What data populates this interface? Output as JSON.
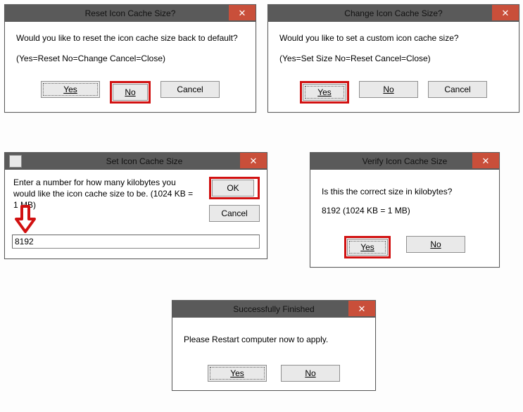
{
  "dialogs": {
    "reset": {
      "title": "Reset Icon Cache Size?",
      "line1": "Would you like to reset the icon cache size back to default?",
      "line2": "(Yes=Reset   No=Change   Cancel=Close)",
      "yes": "Yes",
      "no": "No",
      "cancel": "Cancel"
    },
    "change": {
      "title": "Change Icon Cache Size?",
      "line1": "Would you like to set a custom icon cache size?",
      "line2": "(Yes=Set Size   No=Reset   Cancel=Close)",
      "yes": "Yes",
      "no": "No",
      "cancel": "Cancel"
    },
    "set": {
      "title": "Set Icon Cache Size",
      "line1": "Enter a number for how many kilobytes you would like the icon cache size to be. (1024 KB = 1 MB)",
      "value": "8192",
      "ok": "OK",
      "cancel": "Cancel"
    },
    "verify": {
      "title": "Verify Icon Cache Size",
      "line1": "Is this the correct size in kilobytes?",
      "line2": "8192   (1024 KB = 1 MB)",
      "yes": "Yes",
      "no": "No"
    },
    "finished": {
      "title": "Successfully Finished",
      "line1": "Please Restart computer now to apply.",
      "yes": "Yes",
      "no": "No"
    }
  },
  "close_glyph": "✕"
}
